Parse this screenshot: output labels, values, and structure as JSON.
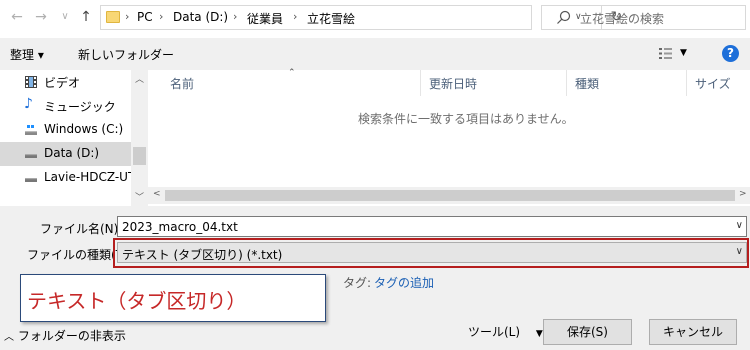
{
  "address_bar": {
    "breadcrumbs": [
      "PC",
      "Data (D:)",
      "従業員",
      "立花雪絵"
    ],
    "search_placeholder": "立花雪絵の検索"
  },
  "toolbar": {
    "organize_label": "整理 ▾",
    "new_folder_label": "新しいフォルダー",
    "help_label": "?"
  },
  "nav_pane": {
    "items": [
      {
        "label": "ビデオ",
        "icon": "video-icon"
      },
      {
        "label": "ミュージック",
        "icon": "music-icon"
      },
      {
        "label": "Windows (C:)",
        "icon": "drive-icon"
      },
      {
        "label": "Data (D:)",
        "icon": "drive-icon",
        "selected": true
      },
      {
        "label": "Lavie-HDCZ-UT",
        "icon": "drive-icon"
      }
    ]
  },
  "file_list": {
    "columns": [
      "名前",
      "更新日時",
      "種類",
      "サイズ"
    ],
    "empty_message": "検索条件に一致する項目はありません。"
  },
  "bottom": {
    "filename_label": "ファイル名(N):",
    "filename_value": "2023_macro_04.txt",
    "filetype_label": "ファイルの種類(T):",
    "filetype_value": "テキスト (タブ区切り) (*.txt)",
    "callout_text": "テキスト（タブ区切り）",
    "tag_label": "タグ:",
    "tag_link": "タグの追加",
    "hide_folders_label": "フォルダーの非表示",
    "tools_label": "ツール(L)",
    "save_label": "保存(S)",
    "cancel_label": "キャンセル"
  },
  "colors": {
    "highlight_frame": "#b51e1e",
    "callout_text": "#c62828",
    "link": "#1a5fb4",
    "help_button": "#1e6fd9"
  }
}
